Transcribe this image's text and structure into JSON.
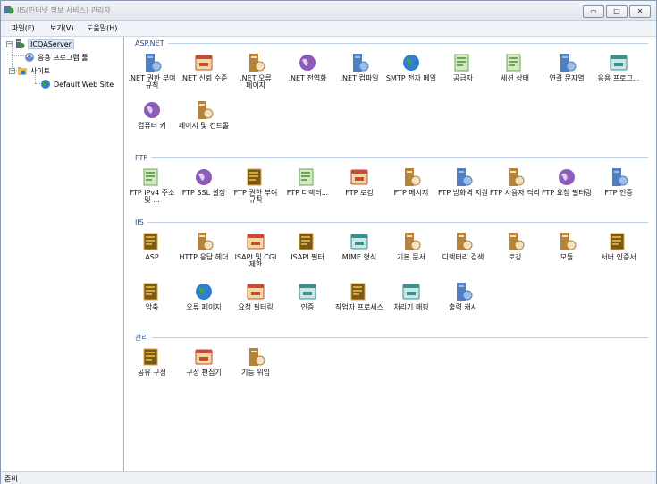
{
  "window": {
    "title": "IIS(인터넷 정보 서비스) 관리자"
  },
  "winbuttons": {
    "minimize": "▭",
    "maximize": "□",
    "close": "✕"
  },
  "menu": {
    "file": "파일(F)",
    "view": "보기(V)",
    "help": "도움말(H)"
  },
  "tree": {
    "server": "ICQAServer",
    "app_pools": "응용 프로그램 풀",
    "sites": "사이트",
    "default_site": "Default Web Site",
    "collapse_sign": "−"
  },
  "sections": {
    "aspnet": "ASP.NET",
    "ftp": "FTP",
    "iis": "IIS",
    "management": "관리"
  },
  "aspnet_features": [
    {
      "label": ".NET 권한 부여 규칙",
      "icon": "authorization-rules-icon"
    },
    {
      "label": ".NET 신뢰 수준",
      "icon": "trust-levels-icon"
    },
    {
      "label": ".NET 오류 페이지",
      "icon": "error-pages-icon"
    },
    {
      "label": ".NET 전역화",
      "icon": "globalization-icon"
    },
    {
      "label": ".NET 컴파일",
      "icon": "compilation-icon"
    },
    {
      "label": "SMTP 전자 메일",
      "icon": "smtp-email-icon"
    },
    {
      "label": "공급자",
      "icon": "providers-icon"
    },
    {
      "label": "세션 상태",
      "icon": "session-state-icon"
    },
    {
      "label": "연결 문자열",
      "icon": "connection-strings-icon"
    },
    {
      "label": "응용 프로그...",
      "icon": "application-settings-icon"
    },
    {
      "label": "컴퓨터 키",
      "icon": "machine-key-icon"
    },
    {
      "label": "페이지 및 컨트롤",
      "icon": "pages-controls-icon"
    }
  ],
  "ftp_features": [
    {
      "label": "FTP IPv4 주소 및 ...",
      "icon": "ftp-ip-restrictions-icon"
    },
    {
      "label": "FTP SSL 설정",
      "icon": "ftp-ssl-icon"
    },
    {
      "label": "FTP 권한 부여 규칙",
      "icon": "ftp-authorization-icon"
    },
    {
      "label": "FTP 디렉터...",
      "icon": "ftp-directory-browsing-icon"
    },
    {
      "label": "FTP 로깅",
      "icon": "ftp-logging-icon"
    },
    {
      "label": "FTP 메시지",
      "icon": "ftp-messages-icon"
    },
    {
      "label": "FTP 방화벽 지원",
      "icon": "ftp-firewall-icon"
    },
    {
      "label": "FTP 사용자 격리",
      "icon": "ftp-user-isolation-icon"
    },
    {
      "label": "FTP 요청 필터링",
      "icon": "ftp-request-filtering-icon"
    },
    {
      "label": "FTP 인증",
      "icon": "ftp-authentication-icon"
    }
  ],
  "iis_features": [
    {
      "label": "ASP",
      "icon": "asp-icon"
    },
    {
      "label": "HTTP 응답 헤더",
      "icon": "http-response-headers-icon"
    },
    {
      "label": "ISAPI 및 CGI 제한",
      "icon": "isapi-cgi-restrictions-icon"
    },
    {
      "label": "ISAPI 필터",
      "icon": "isapi-filters-icon"
    },
    {
      "label": "MIME 형식",
      "icon": "mime-types-icon"
    },
    {
      "label": "기본 문서",
      "icon": "default-document-icon"
    },
    {
      "label": "디렉터리 검색",
      "icon": "directory-browsing-icon"
    },
    {
      "label": "로깅",
      "icon": "logging-icon"
    },
    {
      "label": "모듈",
      "icon": "modules-icon"
    },
    {
      "label": "서버 인증서",
      "icon": "server-certificates-icon"
    },
    {
      "label": "압축",
      "icon": "compression-icon"
    },
    {
      "label": "오류 페이지",
      "icon": "iis-error-pages-icon"
    },
    {
      "label": "요청 필터링",
      "icon": "request-filtering-icon"
    },
    {
      "label": "인증",
      "icon": "authentication-icon"
    },
    {
      "label": "작업자 프로세스",
      "icon": "worker-processes-icon"
    },
    {
      "label": "처리기 매핑",
      "icon": "handler-mappings-icon"
    },
    {
      "label": "출력 캐시",
      "icon": "output-caching-icon"
    }
  ],
  "management_features": [
    {
      "label": "공유 구성",
      "icon": "shared-configuration-icon"
    },
    {
      "label": "구성 편집기",
      "icon": "configuration-editor-icon"
    },
    {
      "label": "기능 위임",
      "icon": "feature-delegation-icon"
    }
  ],
  "status": {
    "text": "준비"
  },
  "colors": {
    "section_header": "#2b4f86",
    "selection": "#dde7f3"
  }
}
